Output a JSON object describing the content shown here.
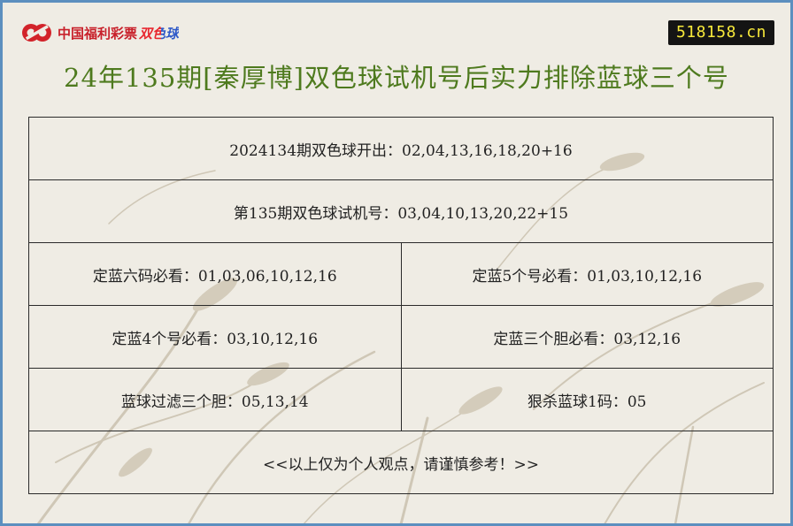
{
  "header": {
    "logo_text": "中国福利彩票",
    "logo_ssq": "双色球",
    "site": "518158.cn"
  },
  "title": "24年135期[秦厚博]双色球试机号后实力排除蓝球三个号",
  "rows": {
    "last_draw": "2024134期双色球开出：02,04,13,16,18,20+16",
    "trial_number": "第135期双色球试机号：03,04,10,13,20,22+15",
    "blue_six": "定蓝六码必看：01,03,06,10,12,16",
    "blue_five": "定蓝5个号必看：01,03,10,12,16",
    "blue_four": "定蓝4个号必看：03,10,12,16",
    "blue_three": "定蓝三个胆必看：03,12,16",
    "blue_filter": "蓝球过滤三个胆：05,13,14",
    "blue_kill": "狠杀蓝球1码：05",
    "disclaimer": "<<以上仅为个人观点，请谨慎参考！>>"
  },
  "colors": {
    "border": "#5c8fbf",
    "title": "#4e7a1e",
    "logo_red": "#c8202a",
    "logo_ssq_red": "#e8262e",
    "logo_ssq_blue": "#2d58c8",
    "badge_bg": "#141414",
    "badge_text": "#f7e93a"
  }
}
